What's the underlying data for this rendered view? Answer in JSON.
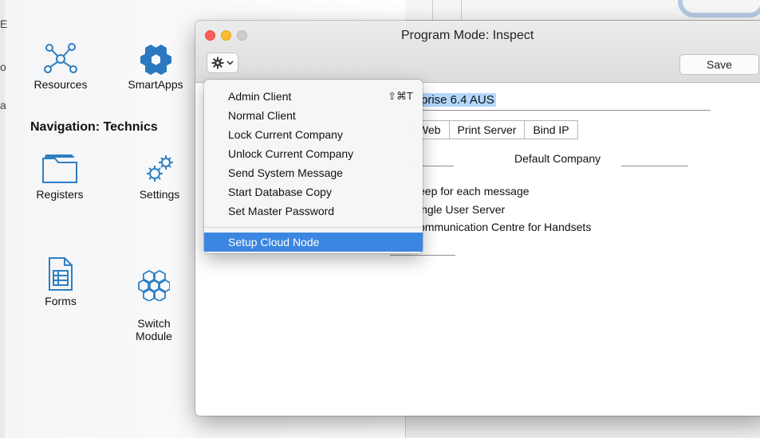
{
  "background": {
    "nav_items": [
      {
        "label": "Resources",
        "icon": "network-nodes-icon"
      },
      {
        "label": "SmartApps",
        "icon": "hexagon-cluster-icon"
      },
      {
        "label": "Registers",
        "icon": "folder-icon"
      },
      {
        "label": "Settings",
        "icon": "gears-icon"
      },
      {
        "label": "Forms",
        "icon": "form-document-icon"
      },
      {
        "label": "Switch\nModule",
        "icon": "hexagon-outline-icon"
      }
    ],
    "nav_heading": "Navigation: Technics",
    "edge_chars": [
      "E",
      "o",
      "a"
    ]
  },
  "window": {
    "title": "Program Mode: Inspect",
    "save_label": "Save",
    "company_name": "rprise 6.4 AUS",
    "tabs": [
      "Web",
      "Print Server",
      "Bind IP"
    ],
    "default_company_label": "Default Company",
    "options": [
      "eep for each message",
      "ingle User Server",
      "ommunication Centre for Handsets"
    ]
  },
  "menu": {
    "items": [
      {
        "label": "Admin Client",
        "shortcut": "⇧⌘T"
      },
      {
        "label": "Normal Client",
        "shortcut": ""
      },
      {
        "label": "Lock Current Company",
        "shortcut": ""
      },
      {
        "label": "Unlock Current Company",
        "shortcut": ""
      },
      {
        "label": "Send System Message",
        "shortcut": ""
      },
      {
        "label": "Start Database Copy",
        "shortcut": ""
      },
      {
        "label": "Set Master Password",
        "shortcut": ""
      }
    ],
    "highlighted": {
      "label": "Setup Cloud Node"
    }
  },
  "colors": {
    "accent": "#3b86e0",
    "close": "#fc5f57",
    "minimize": "#fdbc2e",
    "selection": "#b3d7ff"
  }
}
